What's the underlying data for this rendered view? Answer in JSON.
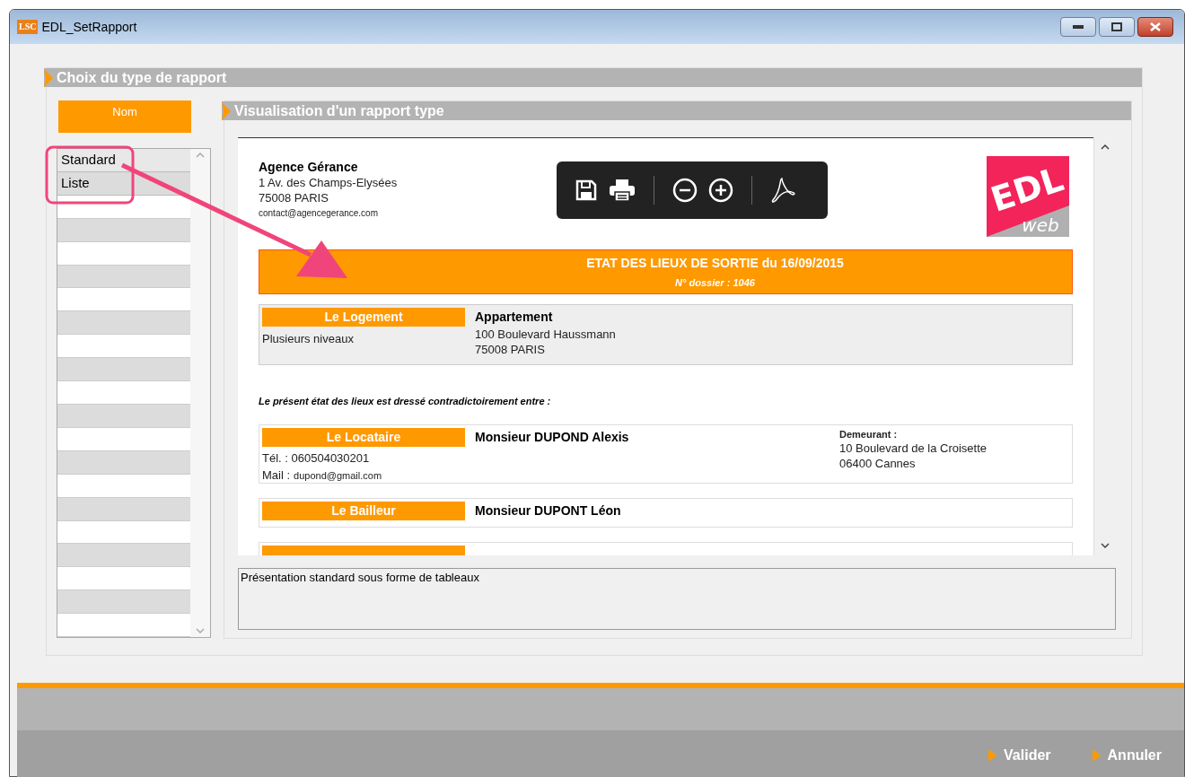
{
  "window": {
    "title": "EDL_SetRapport",
    "app_badge": "LSC"
  },
  "section_title": "Choix du type de rapport",
  "list": {
    "header": "Nom",
    "items": [
      {
        "label": "Standard",
        "selected": true
      },
      {
        "label": "Liste",
        "selected": false
      }
    ]
  },
  "preview": {
    "title": "Visualisation d'un rapport type",
    "agency": {
      "name": "Agence Gérance",
      "lines": [
        "1 Av. des Champs-Elysées",
        "75008 PARIS"
      ],
      "email": "contact@agencegerance.com"
    },
    "logo": {
      "mark": "EDL",
      "tagline": "web"
    },
    "report": {
      "title": "ETAT DES LIEUX DE SORTIE du 16/09/2015",
      "dossier": "N° dossier : 1046"
    },
    "logement": {
      "label": "Le Logement",
      "type": "Appartement",
      "description": "Plusieurs niveaux",
      "address": [
        "100 Boulevard Haussmann",
        "75008 PARIS"
      ]
    },
    "intro": "Le présent état des lieux est dressé contradictoirement entre :",
    "locataire": {
      "label": "Le Locataire",
      "name": "Monsieur DUPOND Alexis",
      "tel": "Tél. : 060504030201",
      "mail_label": "Mail :",
      "mail": "dupond@gmail.com",
      "demeurant_label": "Demeurant :",
      "address": [
        "10 Boulevard de la Croisette",
        "06400 Cannes"
      ]
    },
    "bailleur": {
      "label": "Le Bailleur",
      "name": "Monsieur DUPONT Léon"
    }
  },
  "description": "Présentation standard sous forme de tableaux",
  "buttons": [
    {
      "label": "Valider"
    },
    {
      "label": "Annuler"
    }
  ]
}
